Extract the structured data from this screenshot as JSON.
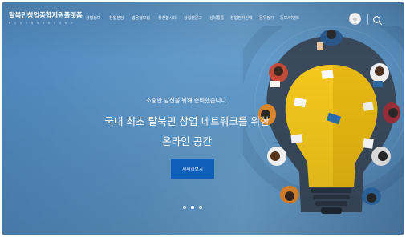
{
  "brand": {
    "name": "탈북민창업종합지원플랫폼",
    "tagline": "N I S S Q U A R E  S  K K"
  },
  "nav": {
    "items": [
      {
        "label": "창업정보"
      },
      {
        "label": "창업분담"
      },
      {
        "label": "법용형모집"
      },
      {
        "label": "창전함시다"
      },
      {
        "label": "창업전문고"
      },
      {
        "label": "심북통통"
      },
      {
        "label": "창업전하신택"
      },
      {
        "label": "동우정기"
      },
      {
        "label": "동보/이벤트"
      }
    ]
  },
  "header": {
    "avatar_icon": "user-avatar-icon",
    "search_icon": "search-icon"
  },
  "hero": {
    "subtitle": "소중한 당신을 위해 준비했습니다.",
    "title_line1": "국내 최초 탈북민 창업 네트워크를 위한",
    "title_line2": "온라인 공간",
    "cta_label": "자세히보기"
  },
  "carousel": {
    "slides": 3,
    "active_index": 1
  },
  "colors": {
    "hero_bg": "#5a92c4",
    "cta_bg": "#0f5fba",
    "bulb": "#f4c81c"
  }
}
